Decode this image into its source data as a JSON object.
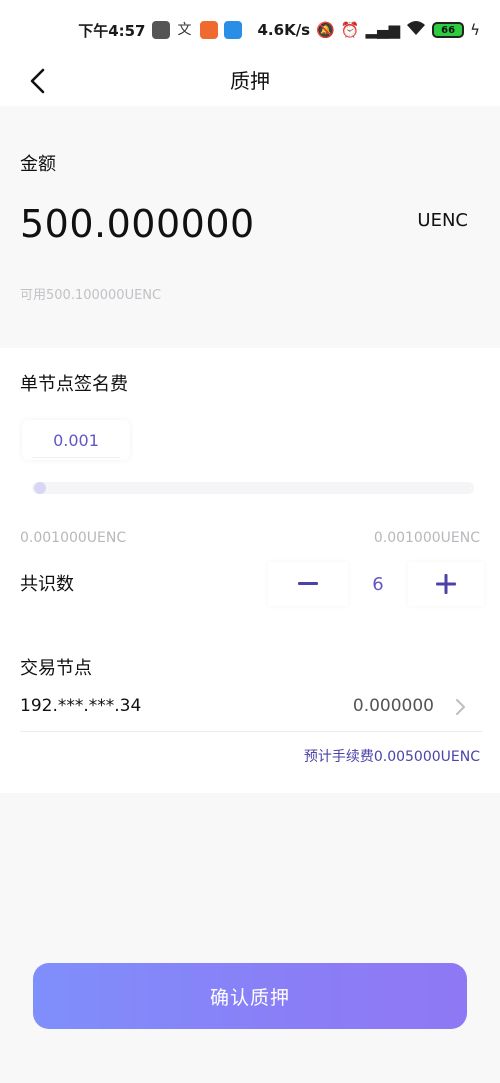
{
  "status_bar": {
    "time": "下午4:57",
    "network_speed": "4.6K/s",
    "battery": "66"
  },
  "header": {
    "title": "质押"
  },
  "amount": {
    "label": "金额",
    "value": "500.000000",
    "unit": "UENC",
    "available": "可用500.100000UENC"
  },
  "fee": {
    "title": "单节点签名费",
    "value": "0.001",
    "slider_level": 0,
    "min_label": "0.001000UENC",
    "max_label": "0.001000UENC"
  },
  "consensus": {
    "label": "共识数",
    "value": "6"
  },
  "nodes": {
    "label": "交易节点",
    "ip": "192.***.***.34",
    "amount": "0.000000"
  },
  "estimated_fee": "预计手续费0.005000UENC",
  "confirm_label": "确认质押",
  "colors": {
    "accent": "#6157c2",
    "button_start": "#7f8ffb",
    "button_end": "#8f78f3"
  }
}
